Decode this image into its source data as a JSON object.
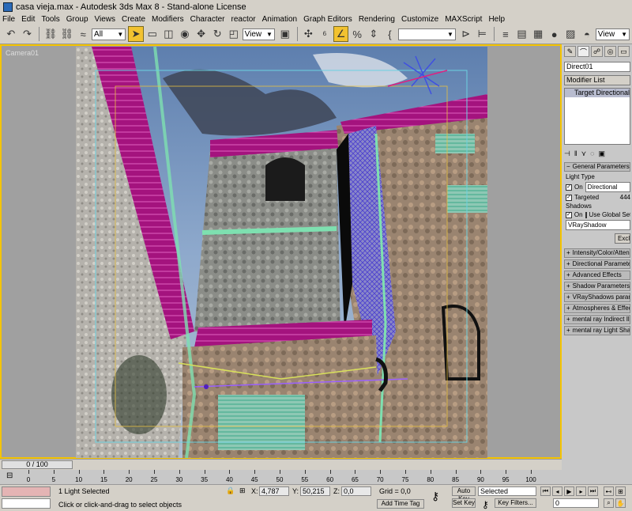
{
  "window": {
    "title": "casa vieja.max - Autodesk 3ds Max 8 - Stand-alone License"
  },
  "menu": [
    "File",
    "Edit",
    "Tools",
    "Group",
    "Views",
    "Create",
    "Modifiers",
    "Character",
    "reactor",
    "Animation",
    "Graph Editors",
    "Rendering",
    "Customize",
    "MAXScript",
    "Help"
  ],
  "toolbar": {
    "selection_filter": "All",
    "ref_coord": "View",
    "named_selection": "",
    "view_dropdown": "View",
    "icons": [
      "undo-icon",
      "redo-icon",
      "link-icon",
      "unlink-icon",
      "bind-space-warp-icon",
      "select-arrow-icon",
      "rect-select-icon",
      "window-crossing-icon",
      "move-icon",
      "rotate-icon",
      "scale-icon",
      "snap-icon",
      "angle-snap-icon",
      "percent-snap-icon",
      "spinner-snap-icon",
      "mirror-icon",
      "align-icon",
      "layer-manager-icon",
      "curve-editor-icon",
      "schematic-icon",
      "material-editor-icon",
      "render-scene-icon",
      "quick-render-icon"
    ]
  },
  "viewport": {
    "label": "Camera01"
  },
  "command_panel": {
    "object_name": "Direct01",
    "modifier_list": "Modifier List",
    "stack_item": "Target Directional Light",
    "general_parameters": "General Parameters",
    "light_type_label": "Light Type",
    "on_label": "On",
    "light_type_value": "Directional",
    "targeted_label": "Targeted",
    "targeted_distance": "444",
    "shadows_label": "Shadows",
    "use_global_label": "Use Global Set",
    "shadow_type": "VRayShadow",
    "exclude_button": "Exclu",
    "rollouts": [
      "Intensity/Color/Attenuati",
      "Directional Parameters",
      "Advanced Effects",
      "Shadow Parameters",
      "VRayShadows params",
      "Atmospheres & Effects",
      "mental ray Indirect Illumina",
      "mental ray Light Shade"
    ]
  },
  "timeline": {
    "slider": "0 / 100",
    "ticks": [
      "0",
      "5",
      "10",
      "15",
      "20",
      "25",
      "30",
      "35",
      "40",
      "45",
      "50",
      "55",
      "60",
      "65",
      "70",
      "75",
      "80",
      "85",
      "90",
      "95",
      "100"
    ]
  },
  "status": {
    "selection": "1 Light Selected",
    "prompt": "Click or click-and-drag to select objects",
    "x_label": "X:",
    "x_value": "4,787",
    "y_label": "Y:",
    "y_value": "50,215",
    "z_label": "Z:",
    "z_value": "0,0",
    "grid": "Grid = 0,0",
    "add_time_tag": "Add Time Tag",
    "auto_key": "Auto Key",
    "set_key": "Set Key",
    "key_mode": "Selected",
    "key_filters": "Key Filters...",
    "frame": "0"
  }
}
